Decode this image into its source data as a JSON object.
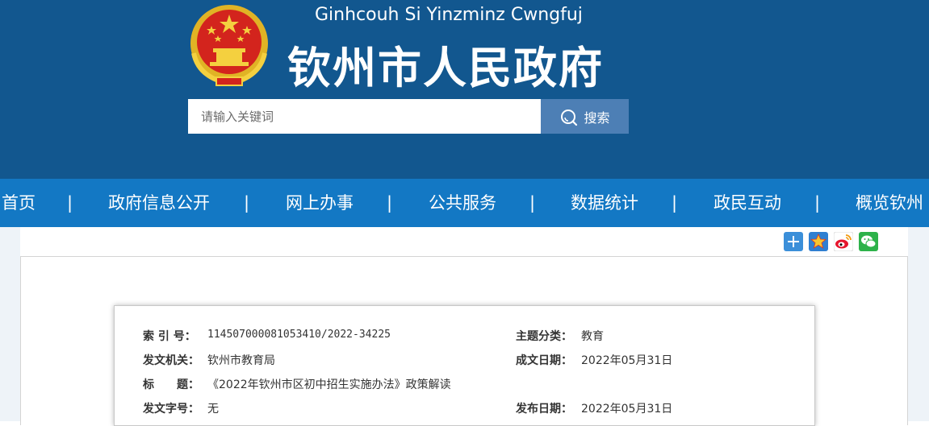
{
  "header": {
    "pinyin": "Ginhcouh Si Yinzminz Cwngfuj",
    "title": "钦州市人民政府",
    "emblem_icon": "national-emblem-icon",
    "bg_color": "#12578f"
  },
  "search": {
    "placeholder": "请输入关键词",
    "button_label": "搜索",
    "button_icon": "search-icon"
  },
  "nav": {
    "separator": "|",
    "items": [
      "首页",
      "政府信息公开",
      "网上办事",
      "公共服务",
      "数据统计",
      "政民互动",
      "概览钦州"
    ],
    "bg_color": "#1378c4"
  },
  "share": {
    "icons": [
      "plus-icon",
      "star-icon",
      "weibo-icon",
      "wechat-icon"
    ]
  },
  "meta": {
    "index_label": "索 引 号：",
    "index_value": "114507000081053410/2022-34225",
    "category_label": "主题分类：",
    "category_value": "教育",
    "issuer_label": "发文机关：",
    "issuer_value": "钦州市教育局",
    "created_label": "成文日期：",
    "created_value": "2022年05月31日",
    "title_label": "标　　题：",
    "title_value": "《2022年钦州市区初中招生实施办法》政策解读",
    "docno_label": "发文字号：",
    "docno_value": "无",
    "published_label": "发布日期：",
    "published_value": "2022年05月31日"
  }
}
